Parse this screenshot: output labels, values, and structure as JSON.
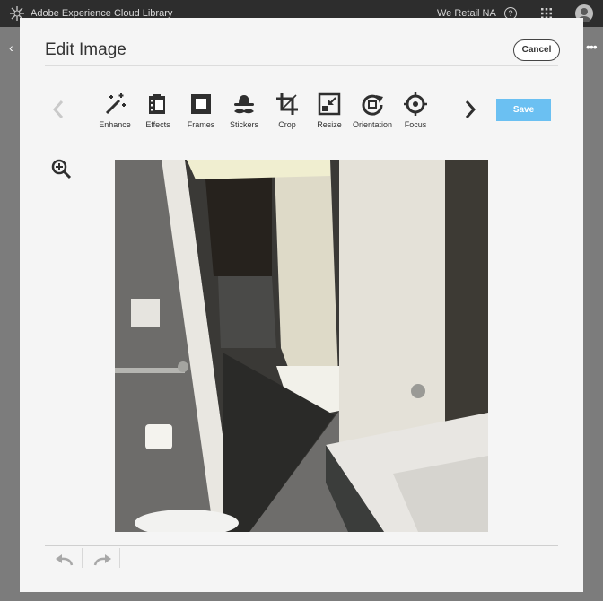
{
  "app": {
    "title": "Adobe Experience Cloud Library",
    "org": "We Retail NA",
    "help_glyph": "?"
  },
  "modal": {
    "title": "Edit Image",
    "cancel_label": "Cancel",
    "save_label": "Save",
    "accent_color": "#6bc0f2"
  },
  "toolbar": {
    "items": [
      {
        "label": "Enhance",
        "icon": "magic-wand-icon"
      },
      {
        "label": "Effects",
        "icon": "film-strip-icon"
      },
      {
        "label": "Frames",
        "icon": "frame-icon"
      },
      {
        "label": "Stickers",
        "icon": "hat-mustache-icon"
      },
      {
        "label": "Crop",
        "icon": "crop-icon"
      },
      {
        "label": "Resize",
        "icon": "resize-icon"
      },
      {
        "label": "Orientation",
        "icon": "rotate-icon"
      },
      {
        "label": "Focus",
        "icon": "focus-target-icon"
      }
    ]
  }
}
